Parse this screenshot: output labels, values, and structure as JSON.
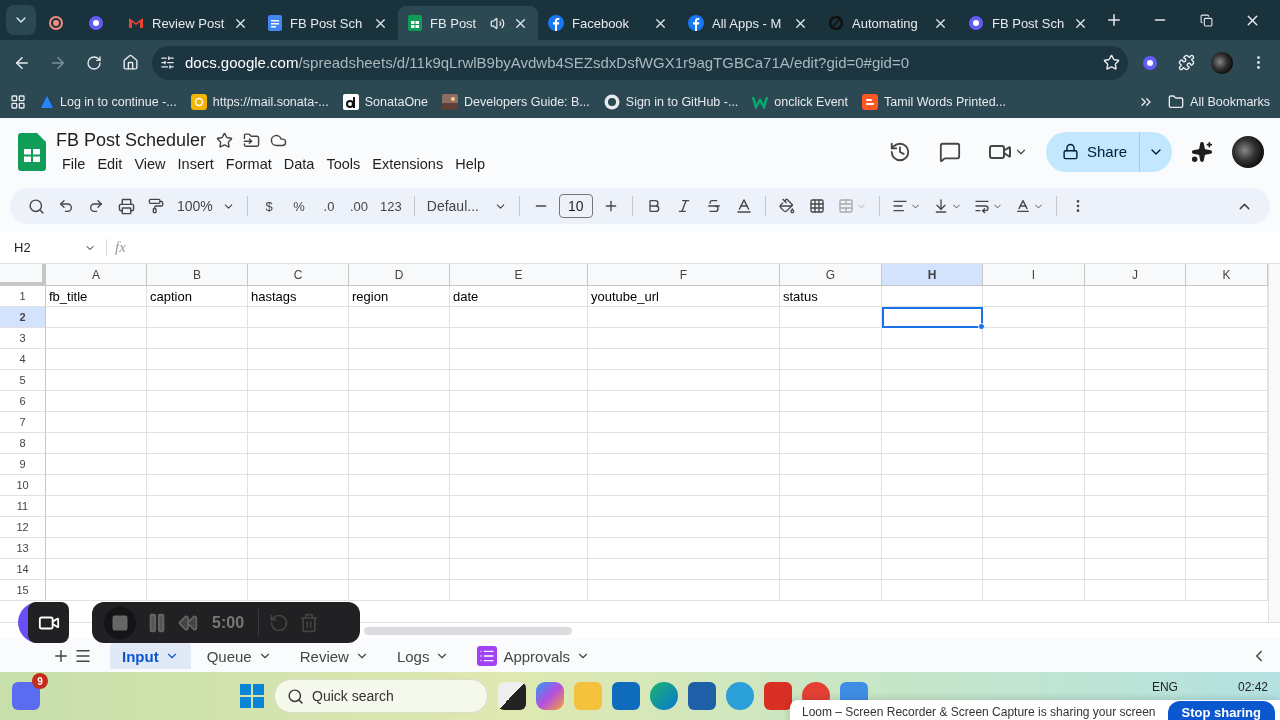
{
  "browser": {
    "tabs": [
      {
        "kind": "record",
        "selected": false
      },
      {
        "kind": "gear",
        "selected": false
      },
      {
        "kind": "gmail",
        "title": "Review Post",
        "selected": false
      },
      {
        "kind": "docs",
        "title": "FB Post Sch",
        "selected": false
      },
      {
        "kind": "sheets",
        "title": "FB Post",
        "selected": true,
        "audio": true
      },
      {
        "kind": "facebook",
        "title": "Facebook",
        "selected": false
      },
      {
        "kind": "facebook",
        "title": "All Apps - M",
        "selected": false
      },
      {
        "kind": "ring",
        "title": "Automating",
        "selected": false
      },
      {
        "kind": "gear",
        "title": "FB Post Sch",
        "selected": false
      }
    ],
    "address": {
      "host": "docs.google.com",
      "path": "/spreadsheets/d/11k9qLrwlB9byAvdwb4SEZsdxDsfWGX1r9agTGBCa71A/edit?gid=0#gid=0"
    },
    "bookmarks": [
      {
        "kind": "atlassian",
        "title": "Log in to continue -..."
      },
      {
        "kind": "mail",
        "title": "https://mail.sonata-..."
      },
      {
        "kind": "d",
        "title": "SonataOne"
      },
      {
        "kind": "photo",
        "title": "Developers Guide: B..."
      },
      {
        "kind": "github",
        "title": "Sign in to GitHub -..."
      },
      {
        "kind": "w",
        "title": "onclick Event"
      },
      {
        "kind": "blogger",
        "title": "Tamil Words Printed..."
      }
    ],
    "all_bookmarks": "All Bookmarks"
  },
  "doc": {
    "title": "FB Post Scheduler",
    "menus": [
      "File",
      "Edit",
      "View",
      "Insert",
      "Format",
      "Data",
      "Tools",
      "Extensions",
      "Help"
    ],
    "share": "Share"
  },
  "toolbar": {
    "zoom": "100%",
    "format_buttons": [
      "$",
      "%",
      ".0",
      ".00",
      "123"
    ],
    "font": "Defaul...",
    "font_size": "10"
  },
  "formula_bar": {
    "name_box": "H2",
    "fx": "fx"
  },
  "sheet": {
    "columns": [
      {
        "letter": "A",
        "selected": false
      },
      {
        "letter": "B",
        "selected": false
      },
      {
        "letter": "C",
        "selected": false
      },
      {
        "letter": "D",
        "selected": false
      },
      {
        "letter": "E",
        "selected": false
      },
      {
        "letter": "F",
        "selected": false
      },
      {
        "letter": "G",
        "selected": false
      },
      {
        "letter": "H",
        "selected": true
      },
      {
        "letter": "I",
        "selected": false
      },
      {
        "letter": "J",
        "selected": false
      },
      {
        "letter": "K",
        "selected": false
      }
    ],
    "rows": [
      {
        "number": "1",
        "selected": false,
        "cells": [
          "fb_title",
          "caption",
          "hastags",
          "region",
          "date",
          "youtube_url",
          "status"
        ]
      },
      {
        "number": "2",
        "selected": true,
        "cells": []
      },
      {
        "number": "3",
        "selected": false,
        "cells": []
      },
      {
        "number": "4",
        "selected": false,
        "cells": []
      },
      {
        "number": "5",
        "selected": false,
        "cells": []
      },
      {
        "number": "6",
        "selected": false,
        "cells": []
      },
      {
        "number": "7",
        "selected": false,
        "cells": []
      },
      {
        "number": "8",
        "selected": false,
        "cells": []
      },
      {
        "number": "9",
        "selected": false,
        "cells": []
      },
      {
        "number": "10",
        "selected": false,
        "cells": []
      },
      {
        "number": "11",
        "selected": false,
        "cells": []
      },
      {
        "number": "12",
        "selected": false,
        "cells": []
      },
      {
        "number": "13",
        "selected": false,
        "cells": []
      },
      {
        "number": "14",
        "selected": false,
        "cells": []
      },
      {
        "number": "15",
        "selected": false,
        "cells": []
      }
    ]
  },
  "sheet_tabs": [
    {
      "name": "Input",
      "selected": true
    },
    {
      "name": "Queue",
      "selected": false
    },
    {
      "name": "Review",
      "selected": false
    },
    {
      "name": "Logs",
      "selected": false
    },
    {
      "name": "Approvals",
      "selected": false,
      "kind": "list"
    }
  ],
  "recorder": {
    "time": "5:00"
  },
  "taskbar": {
    "badge": "9",
    "search_placeholder": "Quick search",
    "language": "ENG",
    "clock": "02:42"
  },
  "share_notice": {
    "text": "Loom – Screen Recorder & Screen Capture is sharing your screen",
    "button": "Stop sharing"
  }
}
